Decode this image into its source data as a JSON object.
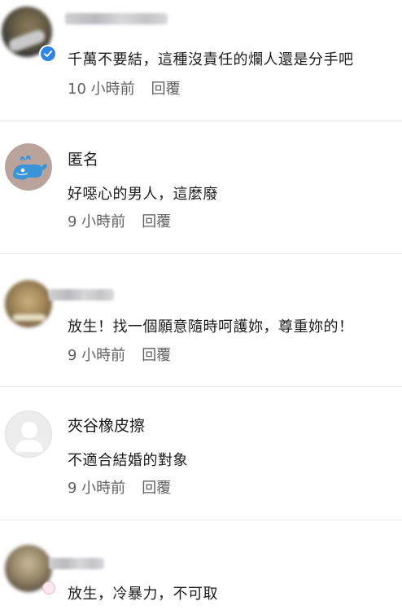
{
  "comments": [
    {
      "name_visible": "",
      "text": "千萬不要結，這種沒責任的爛人還是分手吧",
      "time": "10 小時前",
      "reply": "回覆"
    },
    {
      "name_visible": "匿名",
      "text": "好噁心的男人，這麼廢",
      "time": "9 小時前",
      "reply": "回覆"
    },
    {
      "name_visible": "",
      "text": "放生！找一個願意隨時呵護妳，尊重妳的！",
      "time": "9 小時前",
      "reply": "回覆"
    },
    {
      "name_visible": "夾谷橡皮擦",
      "text": "不適合結婚的對象",
      "time": "9 小時前",
      "reply": "回覆"
    },
    {
      "name_visible": "",
      "text": "放生，冷暴力，不可取",
      "time": "",
      "reply": ""
    }
  ],
  "icons": {
    "verified": "verified-check-icon",
    "whale_avatar": "whale-avatar-icon",
    "default_avatar": "default-user-avatar-icon"
  },
  "colors": {
    "verified_blue": "#2b84e6",
    "whale_bg": "#b9a39a",
    "whale_blue": "#3a95d8",
    "meta_gray": "#616161",
    "divider": "#e6e6e6"
  }
}
